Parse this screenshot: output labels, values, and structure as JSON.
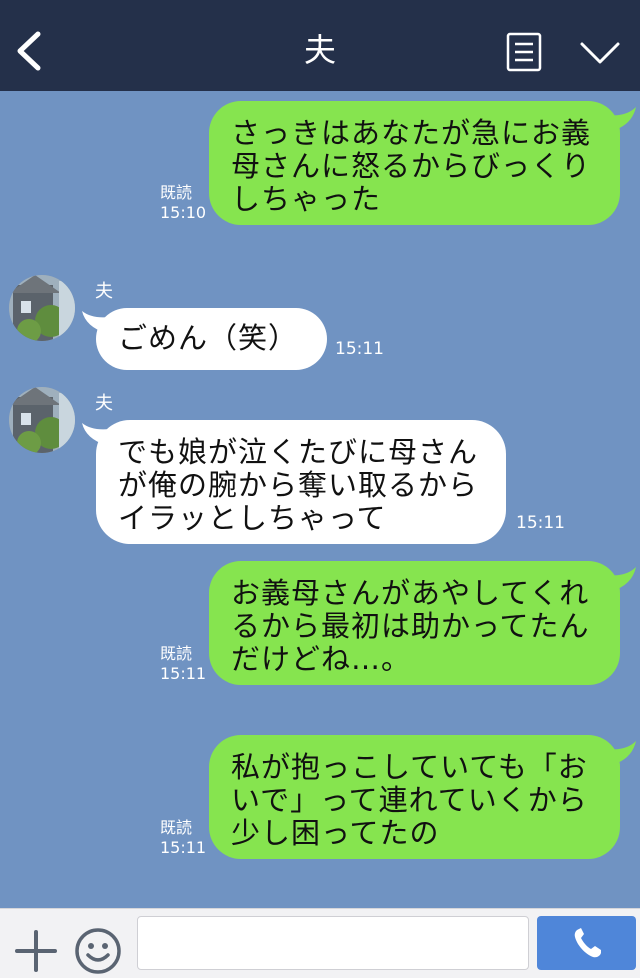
{
  "header": {
    "title": "夫",
    "back_icon": "back-chevron-icon",
    "menu_icon": "menu-icon",
    "collapse_icon": "chevron-down-icon"
  },
  "messages": [
    {
      "side": "me",
      "lines": [
        "さっきはあなたが急にお義",
        "母さんに怒るからびっくり",
        "しちゃった"
      ],
      "read": "既読",
      "time": "15:10"
    },
    {
      "side": "them",
      "sender": "夫",
      "lines": [
        "ごめん（笑）"
      ],
      "time": "15:11"
    },
    {
      "side": "them",
      "sender": "夫",
      "lines": [
        "でも娘が泣くたびに母さん",
        "が俺の腕から奪い取るから",
        "イラッとしちゃって"
      ],
      "time": "15:11"
    },
    {
      "side": "me",
      "lines": [
        "お義母さんがあやしてくれ",
        "るから最初は助かってたん",
        "だけどね…。"
      ],
      "read": "既読",
      "time": "15:11"
    },
    {
      "side": "me",
      "lines": [
        "私が抱っこしていても「お",
        "いで」って連れていくから",
        "少し困ってたの"
      ],
      "read": "既読",
      "time": "15:11"
    }
  ],
  "input_bar": {
    "plus_icon": "plus-icon",
    "emoji_icon": "emoji-icon",
    "placeholder": "",
    "call_icon": "phone-icon"
  },
  "colors": {
    "header_bg": "#24304a",
    "chat_bg": "#7093c2",
    "my_bubble": "#86e44f",
    "their_bubble": "#ffffff",
    "call_button": "#4f86d9"
  }
}
